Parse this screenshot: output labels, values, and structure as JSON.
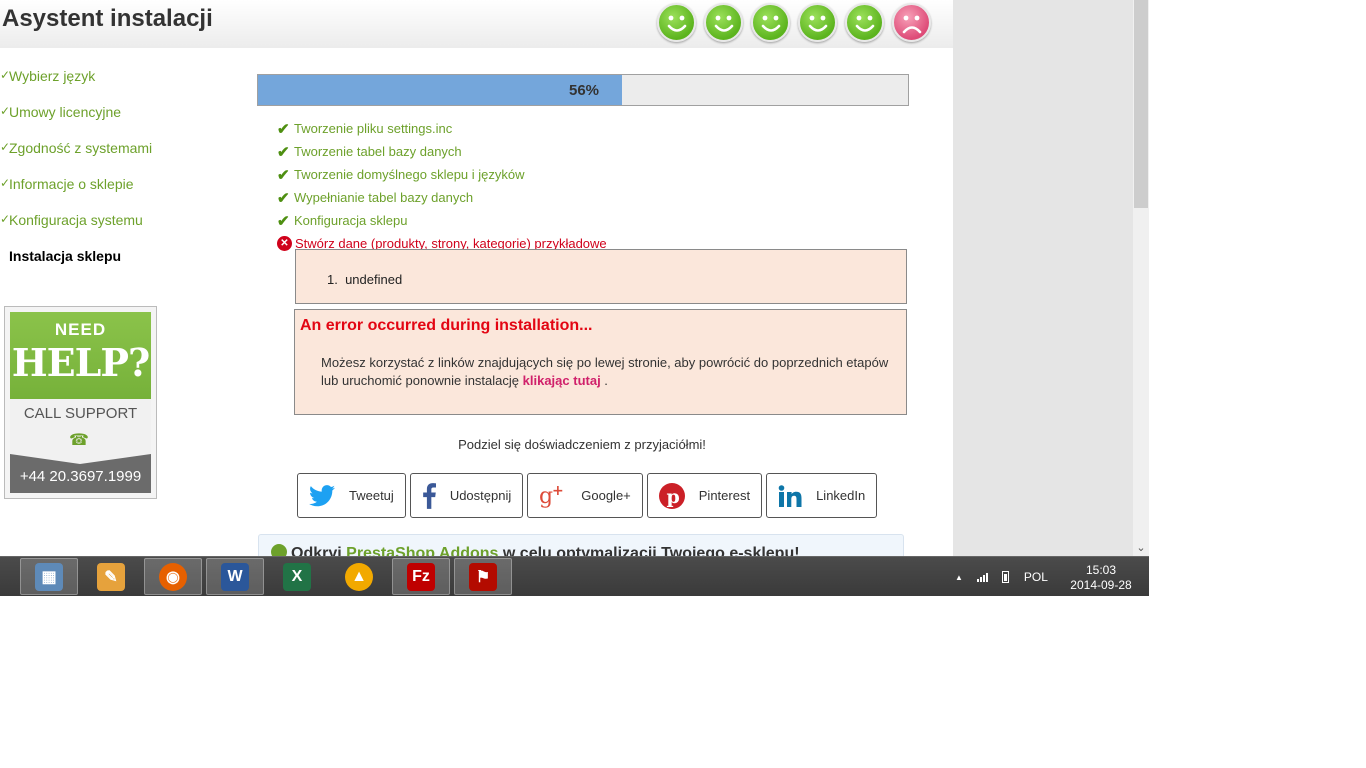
{
  "header": {
    "title": "Asystent instalacji",
    "smileys": [
      "happy",
      "happy",
      "happy",
      "happy",
      "happy",
      "sad"
    ]
  },
  "nav": {
    "steps": [
      {
        "label": "Wybierz język",
        "done": true
      },
      {
        "label": "Umowy licencyjne",
        "done": true
      },
      {
        "label": "Zgodność z systemami",
        "done": true
      },
      {
        "label": "Informacje o sklepie",
        "done": true
      },
      {
        "label": "Konfiguracja systemu",
        "done": true
      },
      {
        "label": "Instalacja sklepu",
        "done": false
      }
    ]
  },
  "help": {
    "need": "NEED",
    "big": "HELP?",
    "call": "CALL SUPPORT",
    "number": "+44 20.3697.1999"
  },
  "progress": {
    "label": "56%",
    "value": 0.56
  },
  "tasks": [
    {
      "label": "Tworzenie pliku settings.inc",
      "status": "ok"
    },
    {
      "label": "Tworzenie tabel bazy danych",
      "status": "ok"
    },
    {
      "label": "Tworzenie domyślnego sklepu i języków",
      "status": "ok"
    },
    {
      "label": "Wypełnianie tabel bazy danych",
      "status": "ok"
    },
    {
      "label": "Konfiguracja sklepu",
      "status": "ok"
    },
    {
      "label": "Stwórz dane (produkty, strony, kategorie) przykładowe",
      "status": "error"
    }
  ],
  "error_list": {
    "number": "1.",
    "item": "undefined"
  },
  "error_box": {
    "title": "An error occurred during installation...",
    "text": "Możesz korzystać z linków znajdujących się po lewej stronie, aby powrócić do poprzednich etapów lub uruchomić ponownie instalację",
    "link": "klikając tutaj",
    "after": " ."
  },
  "share": {
    "title": "Podziel się doświadczeniem z przyjaciółmi!",
    "buttons": [
      {
        "label": "Tweetuj",
        "icon": "twitter-icon",
        "color": "#1da1f2"
      },
      {
        "label": "Udostępnij",
        "icon": "facebook-icon",
        "color": "#3b5998"
      },
      {
        "label": "Google+",
        "icon": "google-plus-icon",
        "color": "#dd4b39"
      },
      {
        "label": "Pinterest",
        "icon": "pinterest-icon",
        "color": "#cb2027"
      },
      {
        "label": "LinkedIn",
        "icon": "linkedin-icon",
        "color": "#0e76a8"
      }
    ]
  },
  "addons": {
    "prefix": "Odkryj ",
    "highlight": "PrestaShop Addons",
    "suffix": " w celu optymalizacji Twojego e-sklepu!"
  },
  "taskbar": {
    "apps": [
      "calculator-icon",
      "paint-icon",
      "firefox-icon",
      "word-icon",
      "excel-icon",
      "aimp-icon",
      "filezilla-icon",
      "acrobat-icon"
    ],
    "active_app": "firefox-icon",
    "language": "POL",
    "time": "15:03",
    "date": "2014-09-28"
  },
  "colors": {
    "green": "#6da12b",
    "error_red": "#d0021b",
    "progress_blue": "#74a6db",
    "error_bg": "#fbe7db"
  }
}
